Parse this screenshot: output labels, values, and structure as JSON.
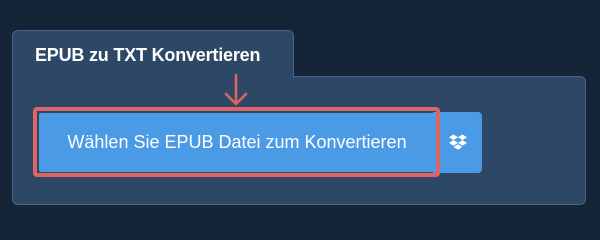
{
  "tab": {
    "title": "EPUB zu TXT Konvertieren"
  },
  "upload": {
    "button_label": "Wählen Sie EPUB Datei zum Konvertieren",
    "dropbox_icon": "dropbox-icon"
  },
  "annotation": {
    "highlight_color": "#e06464",
    "arrow_icon": "arrow-down-icon"
  },
  "colors": {
    "page_background": "#152437",
    "panel_background": "#2c4866",
    "button_blue": "#4a9ae6"
  }
}
